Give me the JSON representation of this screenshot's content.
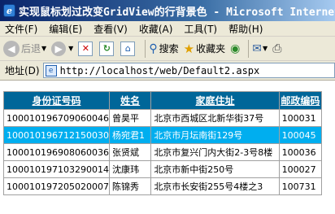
{
  "window": {
    "title": "实现鼠标划过改变GridView的行背景色 - Microsoft Internet Ex"
  },
  "menu": {
    "items": [
      "文件(F)",
      "编辑(E)",
      "查看(V)",
      "收藏(A)",
      "工具(T)",
      "帮助(H)"
    ]
  },
  "toolbar": {
    "back_label": "后退",
    "search_label": "搜索",
    "favorites_label": "收藏夹",
    "icons": [
      "back-icon",
      "forward-icon",
      "stop-icon",
      "refresh-icon",
      "home-icon",
      "search-icon",
      "favorites-icon",
      "media-icon",
      "mail-icon",
      "print-icon"
    ]
  },
  "address": {
    "label": "地址(D)",
    "url": "http://localhost/web/Default2.aspx"
  },
  "grid": {
    "headers": [
      "身份证号码",
      "姓名",
      "家庭住址",
      "邮政编码"
    ],
    "highlight_color": "#00aeef",
    "header_color": "#006699",
    "rows": [
      {
        "id": "100010196709060046",
        "name": "曾昊平",
        "address": "北京市西城区北新华街37号",
        "zip": "100031",
        "highlighted": false
      },
      {
        "id": "100010196712150030",
        "name": "杨宛君1",
        "address": "北京市月坛南街129号",
        "zip": "100045",
        "highlighted": true
      },
      {
        "id": "100010196908060036",
        "name": "张贤斌",
        "address": "北京市复兴门内大街2-3号8楼",
        "zip": "100036",
        "highlighted": false
      },
      {
        "id": "100010197103290014",
        "name": "沈康玮",
        "address": "北京市新中街250号",
        "zip": "100027",
        "highlighted": false
      },
      {
        "id": "100010197205020007",
        "name": "陈锦秀",
        "address": "北京市长安街255号4楼之3",
        "zip": "100731",
        "highlighted": false
      }
    ]
  }
}
